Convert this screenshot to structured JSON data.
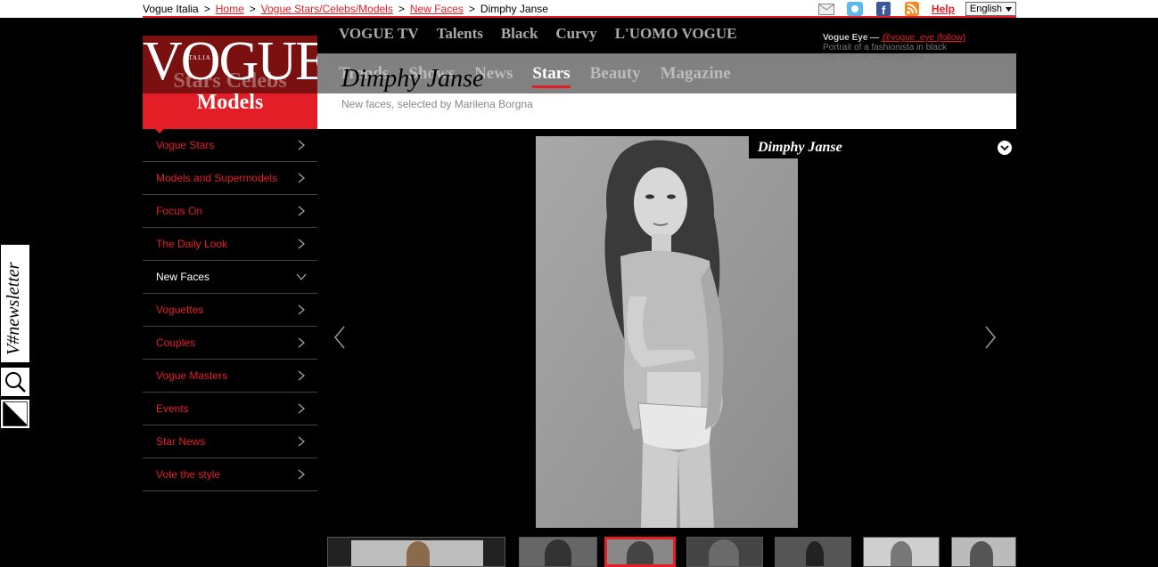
{
  "breadcrumb": {
    "site": "Vogue Italia",
    "items": [
      "Home",
      "Vogue Stars/Celebs/Models",
      "New Faces"
    ],
    "current": "Dimphy Janse",
    "separator": ">"
  },
  "utilities": {
    "icons": [
      "mail-icon",
      "twitter-icon",
      "facebook-icon",
      "rss-icon"
    ],
    "help": "Help",
    "language": "English"
  },
  "logo": {
    "wordmark": "VOGUE",
    "edition": "ITALIA",
    "section_ghost": "Stars Celebs",
    "section": "Models"
  },
  "nav_top": [
    "VOGUE TV",
    "Talents",
    "Black",
    "Curvy",
    "L'UOMO VOGUE"
  ],
  "nav_main": [
    "Trends",
    "Shows",
    "News",
    "Stars",
    "Beauty",
    "Magazine"
  ],
  "nav_main_active": "Stars",
  "vogue_eye": {
    "label": "Vogue Eye —",
    "handle": "@vogue_eye (follow)",
    "text": "Portrait of a fashionista in black",
    "link": "http://tinyurl.com/6ae9ors"
  },
  "page": {
    "title": "Dimphy Janse",
    "subtitle": "New faces, selected by Marilena Borgna"
  },
  "sidebar": {
    "items": [
      {
        "label": "Vogue Stars",
        "active": false
      },
      {
        "label": "Models and Supermodels",
        "active": false
      },
      {
        "label": "Focus On",
        "active": false
      },
      {
        "label": "The Daily Look",
        "active": false
      },
      {
        "label": "New Faces",
        "active": true
      },
      {
        "label": "Voguettes",
        "active": false
      },
      {
        "label": "Couples",
        "active": false
      },
      {
        "label": "Vogue Masters",
        "active": false
      },
      {
        "label": "Events",
        "active": false
      },
      {
        "label": "Star News",
        "active": false
      },
      {
        "label": "Vote the style",
        "active": false
      }
    ]
  },
  "side_tabs": {
    "newsletter": "V#newsletter"
  },
  "gallery": {
    "caption": "Dimphy Janse",
    "thumb_count": 8,
    "selected_thumb": 3
  },
  "colors": {
    "accent": "#e41e26",
    "background": "#000000",
    "title_band": "#888888"
  }
}
